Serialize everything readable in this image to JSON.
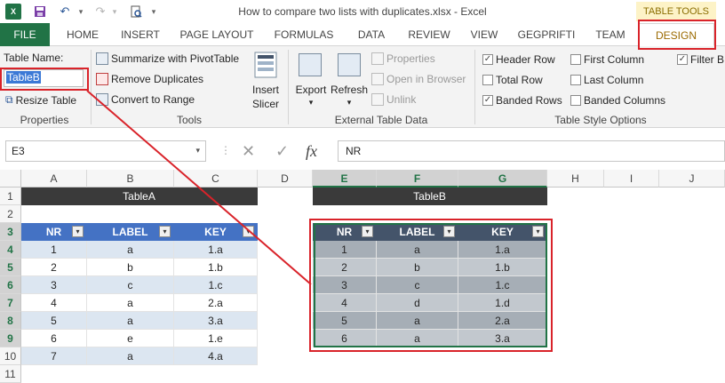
{
  "window": {
    "title": "How to compare two lists with duplicates.xlsx - Excel",
    "table_tools": "TABLE TOOLS"
  },
  "qat": {
    "excel_icon": "excel-icon",
    "save_icon": "save-icon",
    "undo_icon": "undo-icon",
    "redo_icon": "redo-icon",
    "preview_icon": "print-preview-icon"
  },
  "tabs": [
    "FILE",
    "HOME",
    "INSERT",
    "PAGE LAYOUT",
    "FORMULAS",
    "DATA",
    "REVIEW",
    "VIEW",
    "GEGPRIFTI",
    "TEAM",
    "DESIGN"
  ],
  "ribbon": {
    "properties": {
      "table_name_label": "Table Name:",
      "table_name_value": "TableB",
      "resize": "Resize Table",
      "group": "Properties"
    },
    "tools": {
      "summarize": "Summarize with PivotTable",
      "remove_dup": "Remove Duplicates",
      "convert": "Convert to Range",
      "insert_slicer_1": "Insert",
      "insert_slicer_2": "Slicer",
      "group": "Tools"
    },
    "external": {
      "export": "Export",
      "refresh": "Refresh",
      "properties": "Properties",
      "open_browser": "Open in Browser",
      "unlink": "Unlink",
      "group": "External Table Data"
    },
    "style_options": {
      "header_row": "Header Row",
      "total_row": "Total Row",
      "banded_rows": "Banded Rows",
      "first_column": "First Column",
      "last_column": "Last Column",
      "banded_columns": "Banded Columns",
      "filter_button": "Filter B",
      "group": "Table Style Options"
    }
  },
  "formula_bar": {
    "name_box": "E3",
    "formula": "NR",
    "fx": "fx"
  },
  "columns": [
    "A",
    "B",
    "C",
    "D",
    "E",
    "F",
    "G",
    "H",
    "I",
    "J"
  ],
  "rows": [
    "1",
    "2",
    "3",
    "4",
    "5",
    "6",
    "7",
    "8",
    "9",
    "10",
    "11"
  ],
  "tableA": {
    "title": "TableA",
    "headers": [
      "NR",
      "LABEL",
      "KEY"
    ],
    "rows": [
      [
        "1",
        "a",
        "1.a"
      ],
      [
        "2",
        "b",
        "1.b"
      ],
      [
        "3",
        "c",
        "1.c"
      ],
      [
        "4",
        "a",
        "2.a"
      ],
      [
        "5",
        "a",
        "3.a"
      ],
      [
        "6",
        "e",
        "1.e"
      ],
      [
        "7",
        "a",
        "4.a"
      ]
    ]
  },
  "tableB": {
    "title": "TableB",
    "headers": [
      "NR",
      "LABEL",
      "KEY"
    ],
    "rows": [
      [
        "1",
        "a",
        "1.a"
      ],
      [
        "2",
        "b",
        "1.b"
      ],
      [
        "3",
        "c",
        "1.c"
      ],
      [
        "4",
        "d",
        "1.d"
      ],
      [
        "5",
        "a",
        "2.a"
      ],
      [
        "6",
        "a",
        "3.a"
      ]
    ]
  },
  "colors": {
    "excel_green": "#217346",
    "tableA_header": "#4472c4",
    "tableB_header": "#44546a",
    "highlight": "#d9232a"
  }
}
